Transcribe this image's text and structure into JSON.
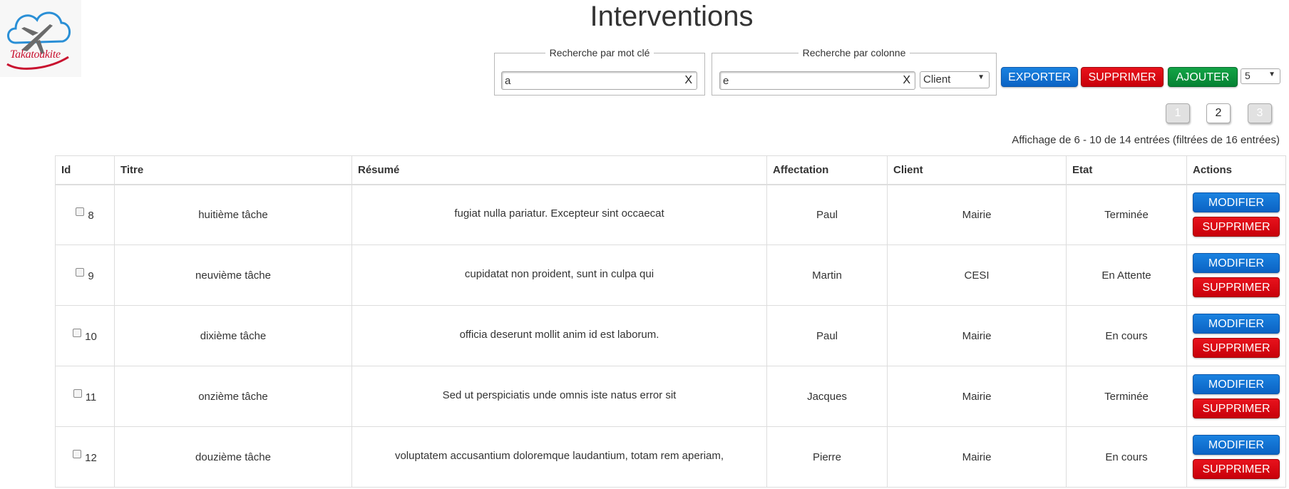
{
  "brand": {
    "logo_text": "Takatoukite"
  },
  "page": {
    "title": "Interventions"
  },
  "search": {
    "keyword_legend": "Recherche par mot clé",
    "keyword_value": "a",
    "column_legend": "Recherche par colonne",
    "column_value": "e",
    "column_select": "Client",
    "clear_label": "X"
  },
  "toolbar": {
    "export_label": "EXPORTER",
    "delete_label": "SUPPRIMER",
    "add_label": "AJOUTER",
    "page_size": "5"
  },
  "pagination": {
    "pages": [
      "1",
      "2",
      "3"
    ],
    "current": "2"
  },
  "entries_info": "Affichage de 6 - 10 de 14 entrées (filtrées de 16 entrées)",
  "table": {
    "headers": [
      "Id",
      "Titre",
      "Résumé",
      "Affectation",
      "Client",
      "Etat",
      "Actions"
    ],
    "rows": [
      {
        "id": "8",
        "titre": "huitième tâche",
        "resume": "fugiat nulla pariatur. Excepteur sint occaecat",
        "affectation": "Paul",
        "client": "Mairie",
        "etat": "Terminée"
      },
      {
        "id": "9",
        "titre": "neuvième tâche",
        "resume": "cupidatat non proident, sunt in culpa qui",
        "affectation": "Martin",
        "client": "CESI",
        "etat": "En Attente"
      },
      {
        "id": "10",
        "titre": "dixième tâche",
        "resume": "officia deserunt mollit anim id est laborum.",
        "affectation": "Paul",
        "client": "Mairie",
        "etat": "En cours"
      },
      {
        "id": "11",
        "titre": "onzième tâche",
        "resume": "Sed ut perspiciatis unde omnis iste natus error sit",
        "affectation": "Jacques",
        "client": "Mairie",
        "etat": "Terminée"
      },
      {
        "id": "12",
        "titre": "douzième tâche",
        "resume": "voluptatem accusantium doloremque laudantium, totam rem aperiam,",
        "affectation": "Pierre",
        "client": "Mairie",
        "etat": "En cours"
      }
    ],
    "modify_label": "MODIFIER",
    "delete_label": "SUPPRIMER"
  },
  "colors": {
    "primary_blue": "#0b63c4",
    "danger_red": "#c8000a",
    "success_green": "#058233"
  }
}
